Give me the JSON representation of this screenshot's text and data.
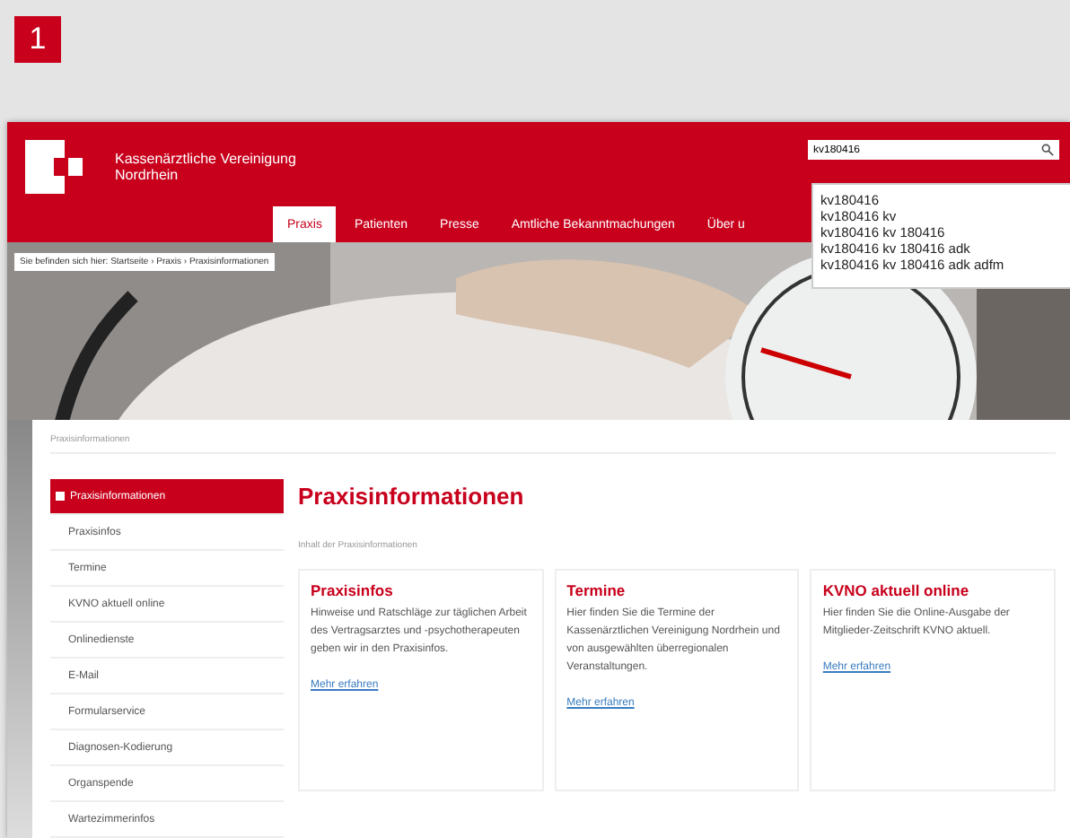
{
  "figure_number": "1",
  "header": {
    "logo_line_1": "Kassenärztliche Vereinigung",
    "logo_line_2": "Nordrhein",
    "search": {
      "value": "kv180416"
    },
    "suggestions": [
      "kv180416",
      "kv180416 kv",
      "kv180416 kv 180416",
      "kv180416 kv 180416 adk",
      "kv180416 kv 180416 adk adfm"
    ],
    "nav": [
      {
        "label": "Praxis",
        "selected": true
      },
      {
        "label": "Patienten",
        "selected": false
      },
      {
        "label": "Presse",
        "selected": false
      },
      {
        "label": "Amtliche Bekanntmachungen",
        "selected": false
      },
      {
        "label": "Über u",
        "selected": false
      }
    ]
  },
  "breadcrumb": "Sie befinden sich hier: Startseite › Praxis › Praxisinformationen",
  "section_label": "Praxisinformationen",
  "sidebar": {
    "items": [
      {
        "label": "Praxisinformationen",
        "selected": true
      },
      {
        "label": "Praxisinfos",
        "selected": false
      },
      {
        "label": "Termine",
        "selected": false
      },
      {
        "label": "KVNO aktuell online",
        "selected": false
      },
      {
        "label": "Onlinedienste",
        "selected": false
      },
      {
        "label": "E-Mail",
        "selected": false
      },
      {
        "label": "Formularservice",
        "selected": false
      },
      {
        "label": "Diagnosen-Kodierung",
        "selected": false
      },
      {
        "label": "Organspende",
        "selected": false
      },
      {
        "label": "Wartezimmerinfos",
        "selected": false
      }
    ]
  },
  "main": {
    "title": "Praxisinformationen",
    "subtitle": "Inhalt der Praxisinformationen",
    "cards": [
      {
        "title": "Praxisinfos",
        "text": "Hinweise und Ratschläge zur täglichen Arbeit des Vertragsarztes und -psychotherapeuten geben wir in den Praxisinfos.",
        "link": "Mehr erfahren"
      },
      {
        "title": "Termine",
        "text": "Hier finden Sie die Termine der Kassenärztlichen Vereinigung Nordrhein und von ausgewählten überregionalen Veranstaltungen.",
        "link": "Mehr erfahren"
      },
      {
        "title": "KVNO aktuell online",
        "text": "Hier finden Sie die Online-Ausgabe der Mitglieder-Zeitschrift KVNO aktuell.",
        "link": "Mehr erfahren"
      }
    ]
  }
}
